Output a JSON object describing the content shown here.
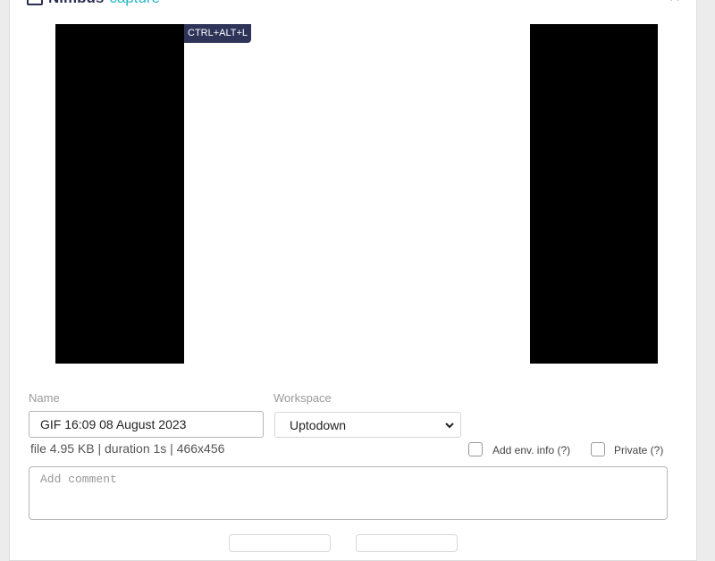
{
  "header": {
    "brand_part1": "Nimbus",
    "brand_part2": "capture",
    "close_symbol": "✕"
  },
  "preview": {
    "hotkey_badge": "CTRL+ALT+L"
  },
  "form": {
    "name_label": "Name",
    "name_value": "GIF 16:09 08 August 2023",
    "workspace_label": "Workspace",
    "workspace_selected": "Uptodown",
    "file_info": "file 4.95 KB | duration 1s | 466x456",
    "add_env_label": "Add env. info (?)",
    "add_env_checked": false,
    "private_label": "Private (?)",
    "private_checked": false,
    "comment_placeholder": "Add comment"
  },
  "colors": {
    "brand_dark": "#2b2f55",
    "brand_accent": "#28b3c7",
    "badge_bg": "#2e3458"
  }
}
